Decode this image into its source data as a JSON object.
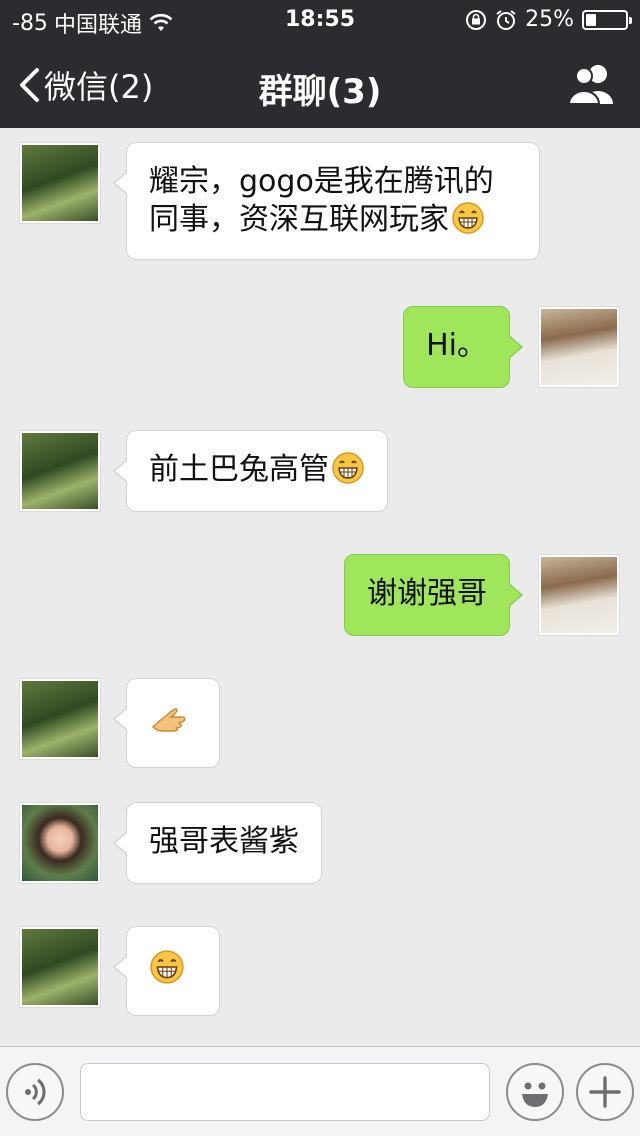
{
  "status_bar": {
    "signal": "-85",
    "carrier": "中国联通",
    "time": "18:55",
    "battery_percent": "25%",
    "battery_level": 0.25,
    "icons": [
      "wifi-icon",
      "rotation-lock-icon",
      "alarm-icon",
      "battery-icon"
    ]
  },
  "nav": {
    "back_label": "微信(2)",
    "title": "群聊(3)",
    "right_icon": "group-members-icon"
  },
  "messages": [
    {
      "side": "left",
      "sender": "bamboo-avatar",
      "text": "耀宗，gogo是我在腾讯的同事，资深互联网玩家",
      "emoji": "grin-emoji"
    },
    {
      "side": "right",
      "sender": "self-avatar",
      "text": "Hi。",
      "emoji": ""
    },
    {
      "side": "left",
      "sender": "bamboo-avatar",
      "text": "前土巴兔高管",
      "emoji": "grin-emoji"
    },
    {
      "side": "right",
      "sender": "self-avatar",
      "text": "谢谢强哥",
      "emoji": ""
    },
    {
      "side": "left",
      "sender": "bamboo-avatar",
      "text": "",
      "emoji": "fist-bump-emoji"
    },
    {
      "side": "left",
      "sender": "woman-avatar",
      "text": "强哥表酱紫",
      "emoji": ""
    },
    {
      "side": "left",
      "sender": "bamboo-avatar",
      "text": "",
      "emoji": "grin-emoji"
    }
  ],
  "input_bar": {
    "placeholder": "",
    "icons": [
      "voice-icon",
      "emoji-icon",
      "plus-icon"
    ]
  },
  "colors": {
    "nav_bg": "#2c2c30",
    "chat_bg": "#ebebeb",
    "self_bubble": "#9fe65b",
    "other_bubble": "#ffffff"
  }
}
